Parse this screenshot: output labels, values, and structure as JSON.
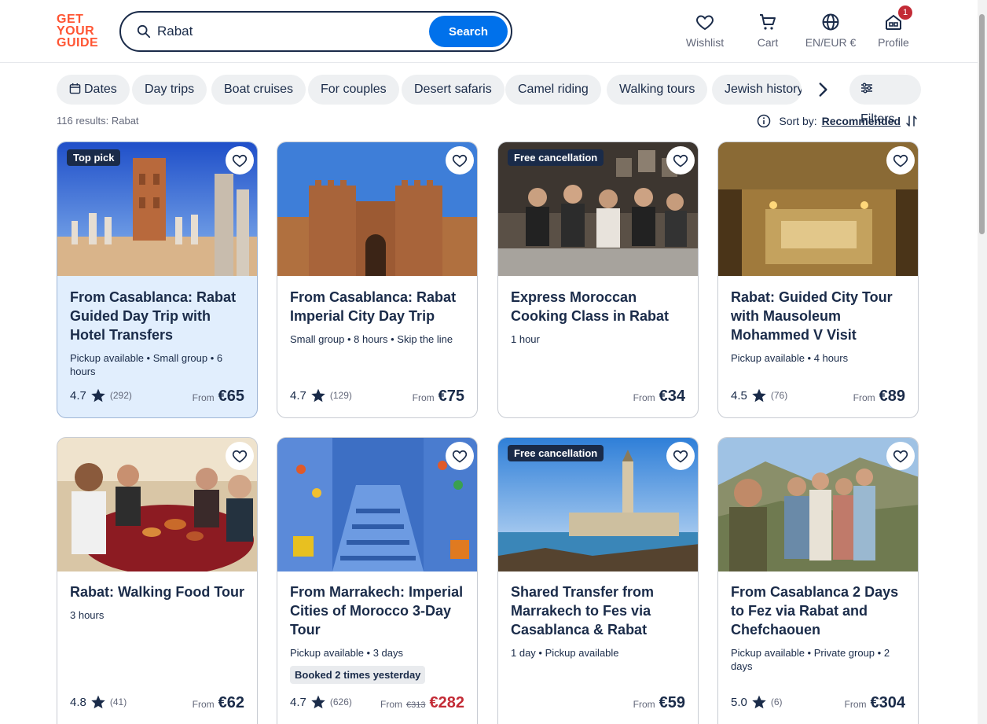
{
  "brand": {
    "line1": "GET",
    "line2": "YOUR",
    "line3": "GUIDE"
  },
  "search": {
    "value": "Rabat",
    "button": "Search"
  },
  "nav": {
    "wishlist": "Wishlist",
    "cart": "Cart",
    "locale": "EN/EUR €",
    "profile": "Profile",
    "profile_badge": "1"
  },
  "chips": {
    "dates": "Dates",
    "items": [
      "Day trips",
      "Boat cruises",
      "For couples",
      "Desert safaris",
      "Camel riding",
      "Walking tours",
      "Jewish history"
    ],
    "filters": "Filters"
  },
  "results": {
    "count_text": "116 results: Rabat",
    "sort_label": "Sort by:",
    "sort_value": "Recommended"
  },
  "cards": [
    {
      "tag": "Top pick",
      "title": "From Casablanca: Rabat Guided Day Trip with Hotel Transfers",
      "meta": "Pickup available • Small group • 6 hours",
      "rating": "4.7",
      "reviews": "(292)",
      "from": "From",
      "price": "€65",
      "highlighted": true
    },
    {
      "tag": "",
      "title": "From Casablanca: Rabat Imperial City Day Trip",
      "meta": "Small group • 8 hours • Skip the line",
      "rating": "4.7",
      "reviews": "(129)",
      "from": "From",
      "price": "€75"
    },
    {
      "tag": "Free cancellation",
      "title": "Express Moroccan Cooking Class in Rabat",
      "meta": "1 hour",
      "rating": "",
      "reviews": "",
      "from": "From",
      "price": "€34"
    },
    {
      "tag": "",
      "title": "Rabat: Guided City Tour with Mausoleum Mohammed V Visit",
      "meta": "Pickup available • 4 hours",
      "rating": "4.5",
      "reviews": "(76)",
      "from": "From",
      "price": "€89"
    },
    {
      "tag": "",
      "title": "Rabat: Walking Food Tour",
      "meta": "3 hours",
      "rating": "4.8",
      "reviews": "(41)",
      "from": "From",
      "price": "€62"
    },
    {
      "tag": "",
      "title": "From Marrakech: Imperial Cities of Morocco 3-Day Tour",
      "meta": "Pickup available • 3 days",
      "booked": "Booked 2 times yesterday",
      "rating": "4.7",
      "reviews": "(626)",
      "from": "From",
      "old_price": "€313",
      "price": "€282"
    },
    {
      "tag": "Free cancellation",
      "title": "Shared Transfer from Marrakech to Fes via Casablanca & Rabat",
      "meta": "1 day • Pickup available",
      "rating": "",
      "reviews": "",
      "from": "From",
      "price": "€59"
    },
    {
      "tag": "",
      "title": "From Casablanca 2 Days to Fez via Rabat and Chefchaouen",
      "meta": "Pickup available • Private group • 2 days",
      "rating": "5.0",
      "reviews": "(6)",
      "from": "From",
      "price": "€304"
    }
  ],
  "colors": {
    "brand": "#ff5533",
    "primary": "#0071eb",
    "navy": "#1a2b49",
    "sale": "#c32b36",
    "highlight": "#e1eefd"
  }
}
